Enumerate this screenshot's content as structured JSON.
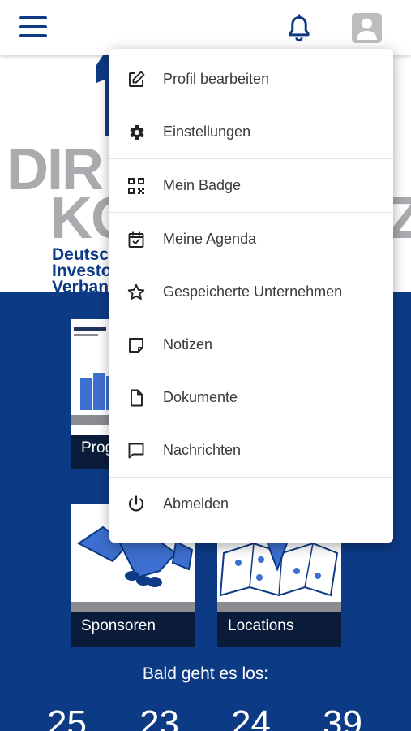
{
  "menu": {
    "items": [
      {
        "label": "Profil bearbeiten",
        "icon": "edit-icon"
      },
      {
        "label": "Einstellungen",
        "icon": "gear-icon"
      },
      {
        "label": "Mein Badge",
        "icon": "qr-code-icon"
      },
      {
        "label": "Meine Agenda",
        "icon": "calendar-check-icon"
      },
      {
        "label": "Gespeicherte Unternehmen",
        "icon": "star-icon"
      },
      {
        "label": "Notizen",
        "icon": "note-icon"
      },
      {
        "label": "Dokumente",
        "icon": "document-icon"
      },
      {
        "label": "Nachrichten",
        "icon": "message-icon"
      },
      {
        "label": "Abmelden",
        "icon": "power-icon"
      }
    ]
  },
  "logo": {
    "line1": "DIR",
    "line1_right": "",
    "line2": "KO",
    "line2_right": "Z",
    "sub1": "Deutsc",
    "sub2": "Investo",
    "sub3": "Verban"
  },
  "tiles": {
    "program_label": "Prog",
    "sponsors_label": "Sponsoren",
    "locations_label": "Locations"
  },
  "countdown": {
    "title": "Bald geht es los:",
    "values": [
      "25",
      "23",
      "24",
      "39"
    ]
  },
  "colors": {
    "brand_blue": "#0d3a85",
    "dark_navy": "#0b1c3b",
    "logo_gray": "#a9abae"
  }
}
